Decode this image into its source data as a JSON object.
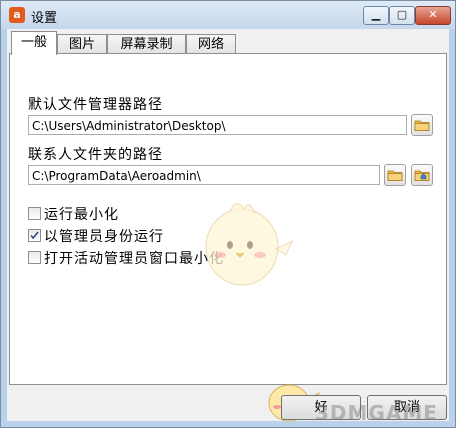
{
  "window": {
    "title": "设置",
    "app_icon_letter": "a",
    "min_glyph": "▁",
    "max_glyph": "▢",
    "close_glyph": "✕"
  },
  "tabs": [
    {
      "label": "一般",
      "active": true
    },
    {
      "label": "图片",
      "active": false
    },
    {
      "label": "屏幕录制",
      "active": false
    },
    {
      "label": "网络",
      "active": false
    }
  ],
  "general": {
    "file_manager_path_label": "默认文件管理器路径",
    "file_manager_path_value": "C:\\Users\\Administrator\\Desktop\\",
    "contacts_folder_label": "联系人文件夹的路径",
    "contacts_folder_value": "C:\\ProgramData\\Aeroadmin\\",
    "options": [
      {
        "label": "运行最小化",
        "checked": false
      },
      {
        "label": "以管理员身份运行",
        "checked": true
      },
      {
        "label": "打开活动管理员窗口最小化",
        "checked": false
      }
    ]
  },
  "buttons": {
    "ok_label": "好",
    "cancel_label": "取消"
  },
  "watermark": "3DMGAME",
  "colors": {
    "titlebar": "#c4d7ec",
    "app_icon": "#e35a1d",
    "close_button": "#c7452c",
    "folder_icon": "#e8b64a"
  }
}
